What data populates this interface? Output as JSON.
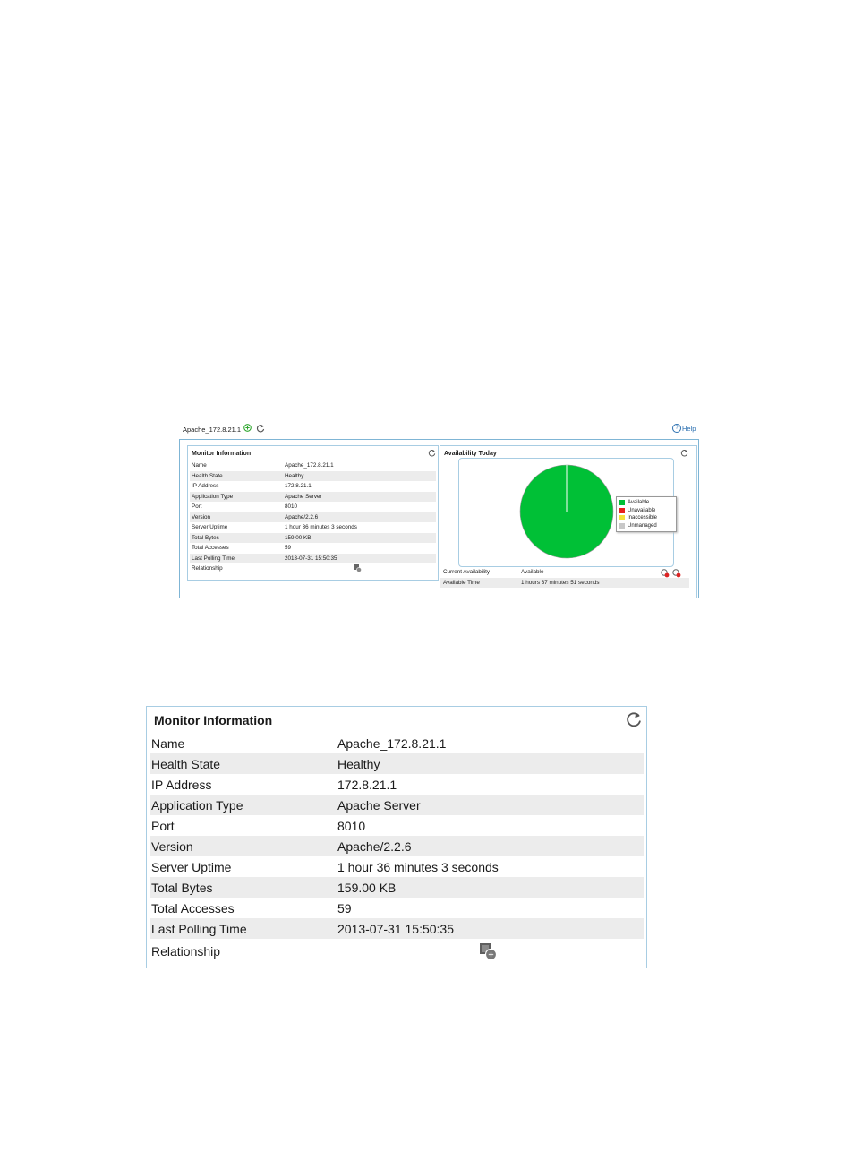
{
  "screenshot": {
    "app_title": "Apache_172.8.21.1",
    "help_label": "Help",
    "monitor": {
      "title": "Monitor Information",
      "rows": [
        {
          "key": "Name",
          "value": "Apache_172.8.21.1"
        },
        {
          "key": "Health State",
          "value": "Healthy"
        },
        {
          "key": "IP Address",
          "value": "172.8.21.1"
        },
        {
          "key": "Application Type",
          "value": "Apache Server"
        },
        {
          "key": "Port",
          "value": "8010"
        },
        {
          "key": "Version",
          "value": "Apache/2.2.6"
        },
        {
          "key": "Server Uptime",
          "value": "1 hour 36 minutes 3 seconds"
        },
        {
          "key": "Total Bytes",
          "value": "159.00 KB"
        },
        {
          "key": "Total Accesses",
          "value": "59"
        },
        {
          "key": "Last Polling Time",
          "value": "2013-07-31 15:50:35"
        }
      ],
      "relationship_label": "Relationship"
    },
    "availability": {
      "title": "Availability Today",
      "legend": [
        {
          "label": "Available",
          "color": "#00c036"
        },
        {
          "label": "Unavailable",
          "color": "#e8201c"
        },
        {
          "label": "Inaccessible",
          "color": "#f5e23c"
        },
        {
          "label": "Unmanaged",
          "color": "#c8c8c8"
        }
      ],
      "pie_share_available": 1.0,
      "current_availability_label": "Current Availability",
      "current_availability_value": "Available",
      "available_time_label": "Available Time",
      "available_time_value": "1 hours 37 minutes 51 seconds"
    }
  },
  "big_panel": {
    "title": "Monitor Information",
    "rows": [
      {
        "key": "Name",
        "value": "Apache_172.8.21.1"
      },
      {
        "key": "Health State",
        "value": "Healthy"
      },
      {
        "key": "IP Address",
        "value": "172.8.21.1"
      },
      {
        "key": "Application Type",
        "value": "Apache Server"
      },
      {
        "key": "Port",
        "value": "8010"
      },
      {
        "key": "Version",
        "value": "Apache/2.2.6"
      },
      {
        "key": "Server Uptime",
        "value": "1 hour 36 minutes 3 seconds"
      },
      {
        "key": "Total Bytes",
        "value": "159.00 KB"
      },
      {
        "key": "Total Accesses",
        "value": "59"
      },
      {
        "key": "Last Polling Time",
        "value": "2013-07-31 15:50:35"
      }
    ],
    "relationship_label": "Relationship"
  }
}
